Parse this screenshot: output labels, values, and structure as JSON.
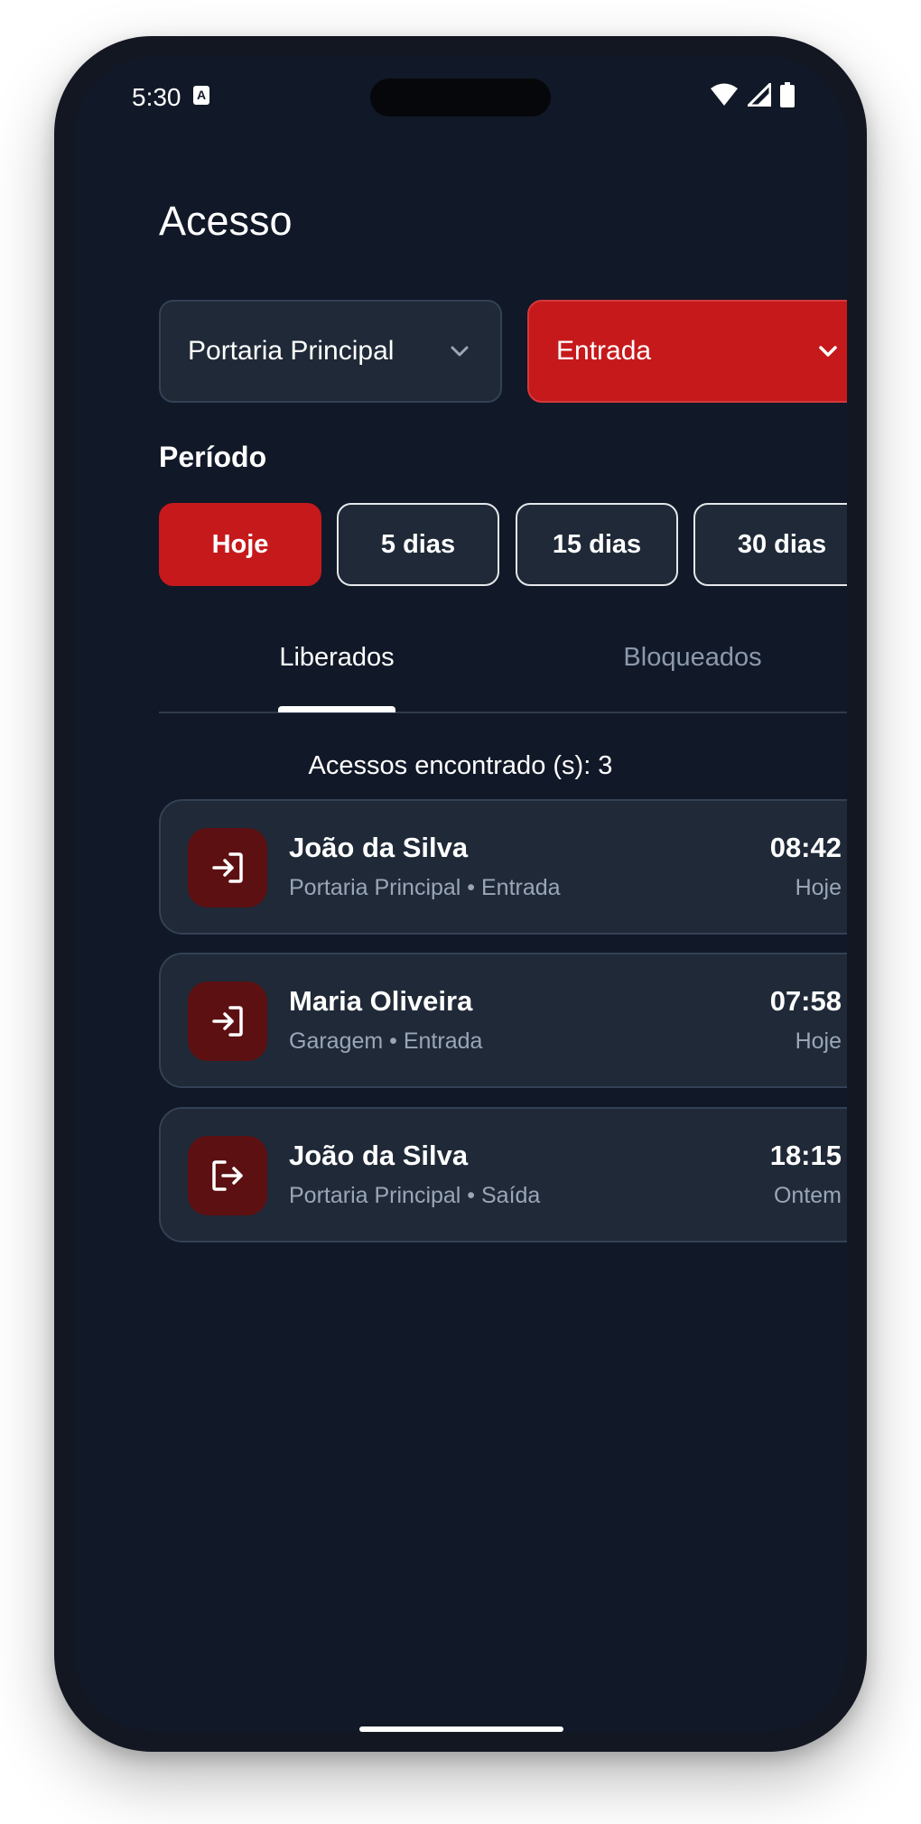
{
  "status_bar": {
    "time": "5:30",
    "notification_glyph": "A"
  },
  "header": {
    "title": "Acesso"
  },
  "filters": {
    "location": {
      "label": "Portaria Principal"
    },
    "direction": {
      "label": "Entrada"
    }
  },
  "period": {
    "label": "Período",
    "options": [
      {
        "label": "Hoje",
        "active": true
      },
      {
        "label": "5 dias",
        "active": false
      },
      {
        "label": "15 dias",
        "active": false
      },
      {
        "label": "30 dias",
        "active": false
      }
    ]
  },
  "tabs": [
    {
      "label": "Liberados",
      "active": true
    },
    {
      "label": "Bloqueados",
      "active": false
    }
  ],
  "results": {
    "count_text": "Acessos encontrado (s): 3"
  },
  "access_list": [
    {
      "name": "João da Silva",
      "detail": "Portaria Principal • Entrada",
      "time": "08:42",
      "day": "Hoje",
      "icon": "login-icon"
    },
    {
      "name": "Maria Oliveira",
      "detail": "Garagem • Entrada",
      "time": "07:58",
      "day": "Hoje",
      "icon": "login-icon"
    },
    {
      "name": "João da Silva",
      "detail": "Portaria Principal • Saída",
      "time": "18:15",
      "day": "Ontem",
      "icon": "logout-icon"
    }
  ],
  "colors": {
    "background": "#111827",
    "card": "#1f2937",
    "accent_red": "#c6191c",
    "icon_bg": "#5d1012",
    "muted_text": "#9aa6b8"
  }
}
